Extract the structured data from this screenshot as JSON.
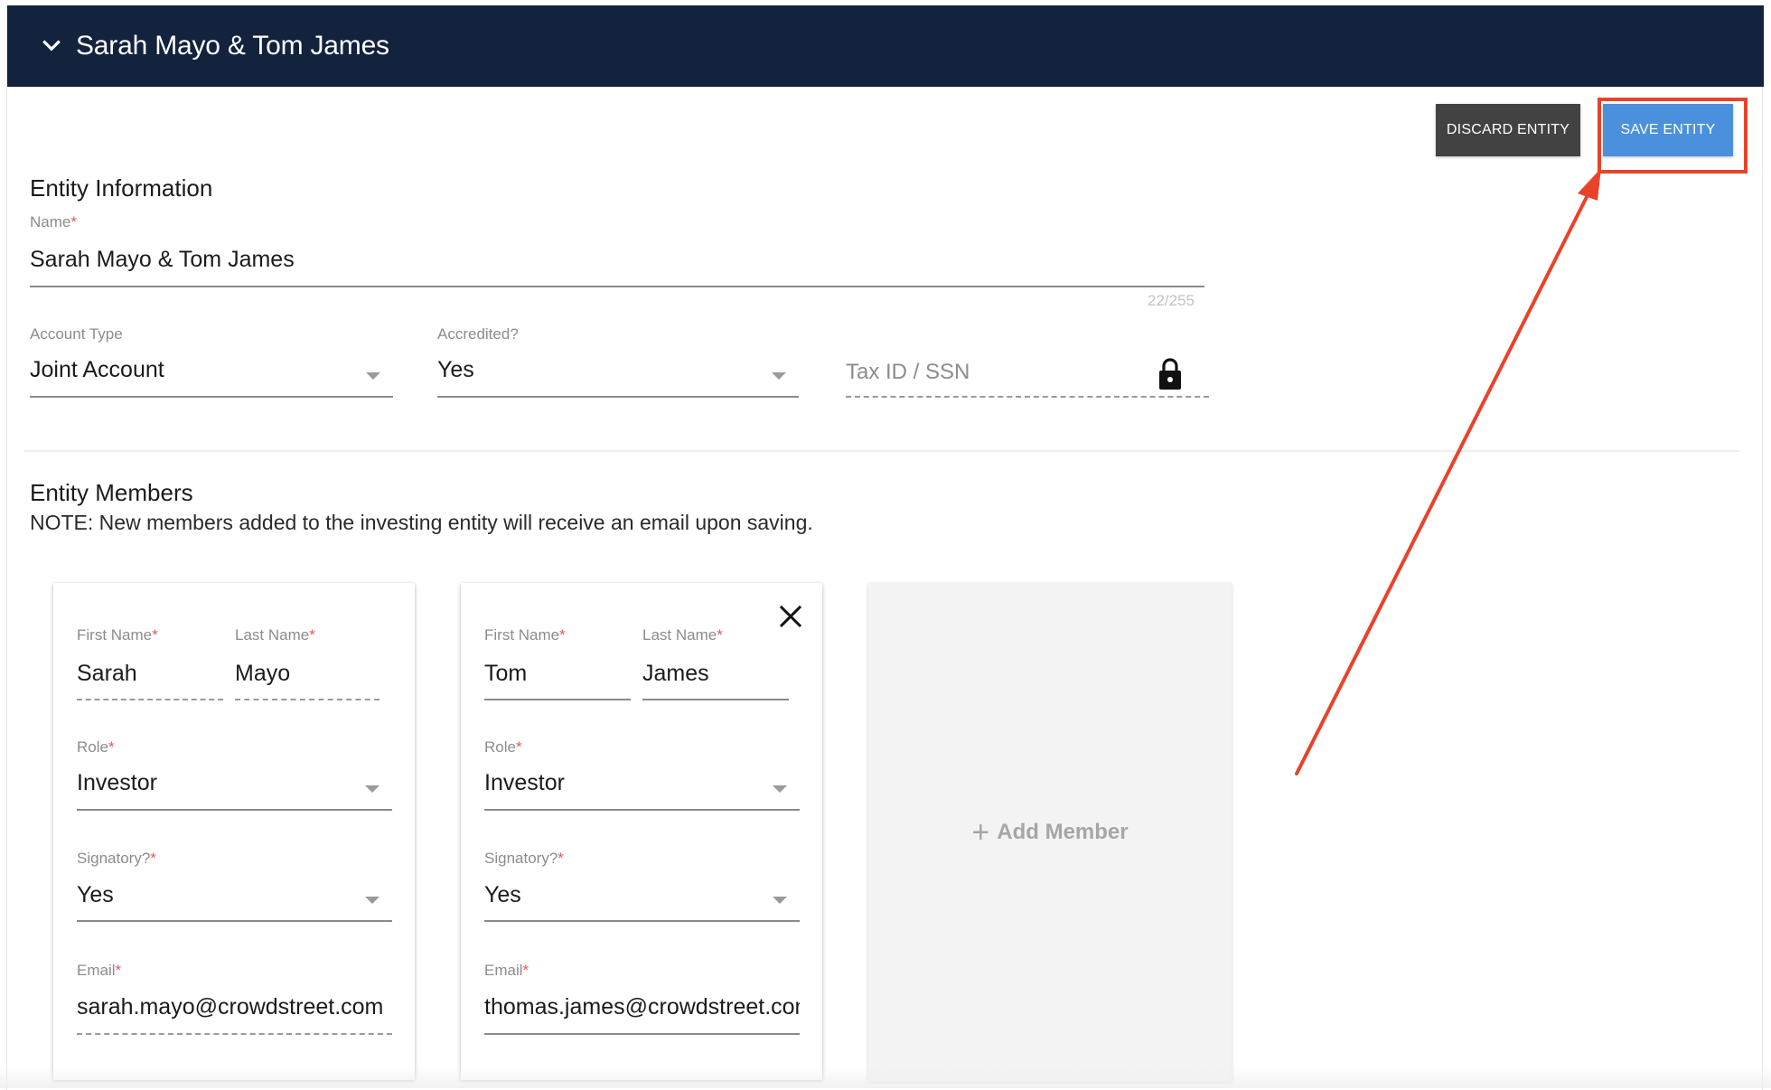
{
  "header": {
    "title": "Sarah Mayo & Tom James"
  },
  "actions": {
    "discard_label": "DISCARD ENTITY",
    "save_label": "SAVE ENTITY"
  },
  "entity_info": {
    "section_title": "Entity Information",
    "name": {
      "label": "Name",
      "value": "Sarah Mayo & Tom James",
      "counter": "22/255"
    },
    "account_type": {
      "label": "Account Type",
      "value": "Joint Account"
    },
    "accredited": {
      "label": "Accredited?",
      "value": "Yes"
    },
    "tax_id": {
      "placeholder": "Tax ID / SSN",
      "icon": "lock-icon"
    }
  },
  "entity_members": {
    "section_title": "Entity Members",
    "note": "NOTE: New members added to the investing entity will receive an email upon saving.",
    "members": [
      {
        "first_name_label": "First Name",
        "first_name": "Sarah",
        "last_name_label": "Last Name",
        "last_name": "Mayo",
        "role_label": "Role",
        "role": "Investor",
        "signatory_label": "Signatory?",
        "signatory": "Yes",
        "email_label": "Email",
        "email": "sarah.mayo@crowdstreet.com"
      },
      {
        "first_name_label": "First Name",
        "first_name": "Tom",
        "last_name_label": "Last Name",
        "last_name": "James",
        "role_label": "Role",
        "role": "Investor",
        "signatory_label": "Signatory?",
        "signatory": "Yes",
        "email_label": "Email",
        "email": "thomas.james@crowdstreet.com"
      }
    ],
    "add_member_label": "Add Member"
  },
  "colors": {
    "header_bg": "#13223d",
    "save_button": "#4a90dc",
    "discard_button": "#424242",
    "annotation": "#e8432a",
    "required_marker": "#e05a5a"
  }
}
